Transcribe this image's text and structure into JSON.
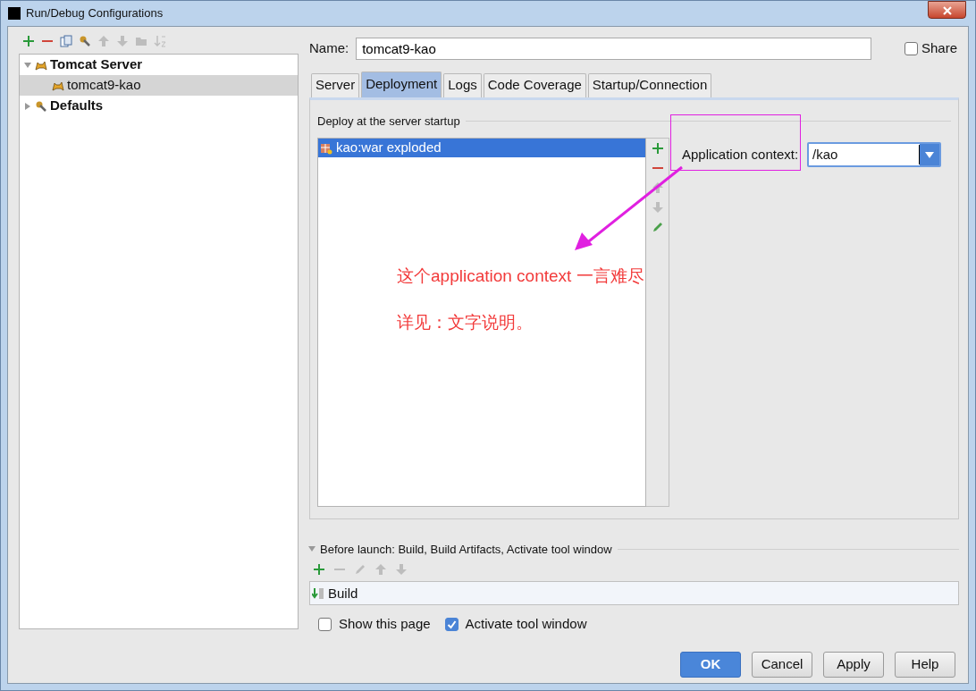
{
  "window": {
    "title": "Run/Debug Configurations"
  },
  "toolbar": [
    {
      "kind": "add",
      "disabled": false
    },
    {
      "kind": "remove",
      "disabled": false
    },
    {
      "kind": "copy",
      "disabled": false
    },
    {
      "kind": "wrench",
      "disabled": false
    },
    {
      "kind": "up",
      "disabled": true
    },
    {
      "kind": "down",
      "disabled": true
    },
    {
      "kind": "folder",
      "disabled": true
    },
    {
      "kind": "sort",
      "disabled": true
    }
  ],
  "tree": [
    {
      "label": "Tomcat Server",
      "kind": "tomcat",
      "expanded": true,
      "selected": false,
      "children": [
        {
          "label": "tomcat9-kao",
          "kind": "tomcat",
          "selected": true
        }
      ]
    },
    {
      "label": "Defaults",
      "kind": "wrench",
      "expanded": false,
      "selected": false
    }
  ],
  "name_field": {
    "label": "Name:",
    "value": "tomcat9-kao"
  },
  "share": {
    "label": "Share",
    "checked": false
  },
  "tabs": [
    {
      "label": "Server",
      "selected": false
    },
    {
      "label": "Deployment",
      "selected": true
    },
    {
      "label": "Logs",
      "selected": false
    },
    {
      "label": "Code Coverage",
      "selected": false
    },
    {
      "label": "Startup/Connection",
      "selected": false
    }
  ],
  "deploy": {
    "title": "Deploy at the server startup",
    "items": [
      {
        "label": "kao:war exploded",
        "selected": true
      }
    ],
    "toolbar": [
      {
        "kind": "add",
        "disabled": false
      },
      {
        "kind": "remove",
        "disabled": false
      },
      {
        "kind": "up",
        "disabled": true
      },
      {
        "kind": "down",
        "disabled": true
      },
      {
        "kind": "edit",
        "disabled": false
      }
    ]
  },
  "context": {
    "label": "Application context:",
    "value": "/kao"
  },
  "annotation": {
    "lines": [
      "这个application context 一言难尽",
      "详见：文字说明。"
    ]
  },
  "before_launch": {
    "title": "Before launch: Build, Build Artifacts, Activate tool window",
    "expanded": true,
    "toolbar": [
      {
        "kind": "add",
        "disabled": false
      },
      {
        "kind": "remove",
        "disabled": true
      },
      {
        "kind": "edit",
        "disabled": true
      },
      {
        "kind": "up",
        "disabled": true
      },
      {
        "kind": "down",
        "disabled": true
      }
    ],
    "tasks": [
      {
        "label": "Build"
      }
    ]
  },
  "options": [
    {
      "label": "Show this page",
      "checked": false
    },
    {
      "label": "Activate tool window",
      "checked": true
    }
  ],
  "buttons": [
    {
      "label": "OK",
      "kind": "primary"
    },
    {
      "label": "Cancel",
      "kind": "normal"
    },
    {
      "label": "Apply",
      "kind": "normal"
    },
    {
      "label": "Help",
      "kind": "normal"
    }
  ]
}
